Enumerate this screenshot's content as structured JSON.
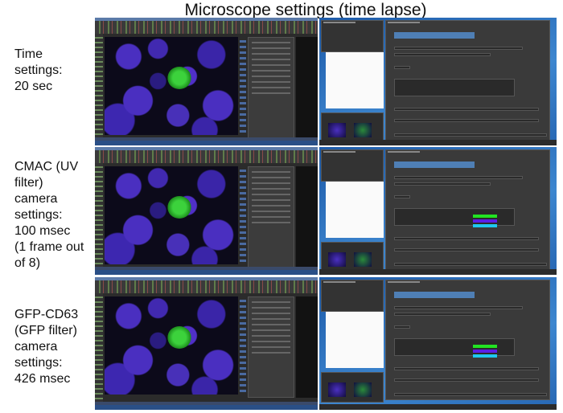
{
  "title": "Microscope settings (time lapse)",
  "rows": [
    {
      "label": "Time\nsettings:\n20 sec",
      "colors": []
    },
    {
      "label": "CMAC (UV\nfilter)\ncamera\nsettings:\n100 msec\n(1 frame out\nof 8)",
      "colors": [
        "#22e322",
        "#5a1ee6",
        "#1ec8f0"
      ]
    },
    {
      "label": "GFP-CD63\n(GFP filter)\ncamera\nsettings:\n426 msec",
      "colors": [
        "#22e322",
        "#5a1ee6",
        "#1ec8f0"
      ]
    }
  ]
}
